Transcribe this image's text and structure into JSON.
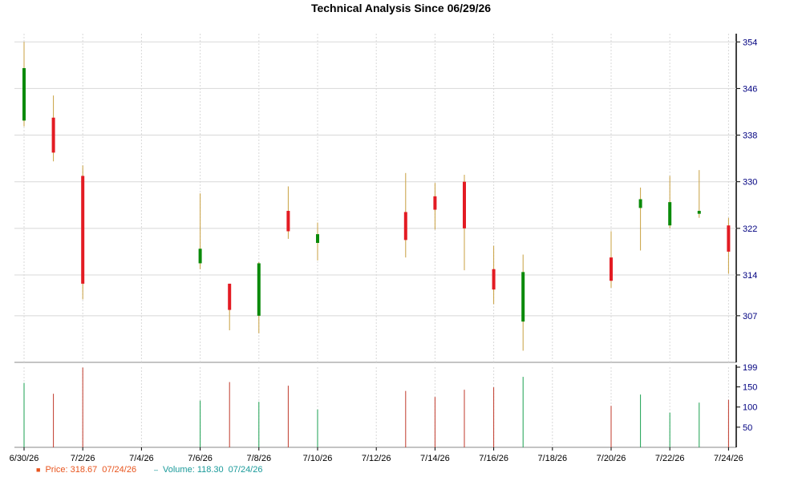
{
  "chart_data": {
    "type": "candlestick",
    "title": "Technical Analysis Since 06/29/26",
    "price_axis": {
      "ylim": [
        299,
        355
      ],
      "ticks": [
        307,
        314,
        322,
        330,
        338,
        346,
        354
      ]
    },
    "volume_axis": {
      "ylim": [
        0,
        199
      ],
      "ticks": [
        50,
        100,
        150,
        199
      ]
    },
    "x_tick_labels": [
      "6/30/26",
      "7/2/26",
      "7/4/26",
      "7/6/26",
      "7/8/26",
      "7/10/26",
      "7/12/26",
      "7/14/26",
      "7/16/26",
      "7/18/26",
      "7/20/26",
      "7/22/26",
      "7/24/26"
    ],
    "grid": true,
    "candles": [
      {
        "date": "6/30/26",
        "open": 340.5,
        "high": 354.0,
        "low": 339.5,
        "close": 349.5,
        "volume": 160
      },
      {
        "date": "7/1/26",
        "open": 341.0,
        "high": 344.8,
        "low": 333.5,
        "close": 335.0,
        "volume": 133
      },
      {
        "date": "7/2/26",
        "open": 331.0,
        "high": 332.8,
        "low": 309.8,
        "close": 312.5,
        "volume": 198
      },
      {
        "date": "7/6/26",
        "open": 316.0,
        "high": 328.0,
        "low": 315.0,
        "close": 318.5,
        "volume": 116
      },
      {
        "date": "7/7/26",
        "open": 312.5,
        "high": 312.5,
        "low": 304.5,
        "close": 308.0,
        "volume": 162
      },
      {
        "date": "7/8/26",
        "open": 307.0,
        "high": 316.2,
        "low": 304.0,
        "close": 316.0,
        "volume": 113
      },
      {
        "date": "7/9/26",
        "open": 325.0,
        "high": 329.2,
        "low": 320.2,
        "close": 321.5,
        "volume": 153
      },
      {
        "date": "7/10/26",
        "open": 319.5,
        "high": 323.0,
        "low": 316.5,
        "close": 321.0,
        "volume": 94
      },
      {
        "date": "7/13/26",
        "open": 324.8,
        "high": 331.5,
        "low": 317.0,
        "close": 320.0,
        "volume": 140
      },
      {
        "date": "7/14/26",
        "open": 327.5,
        "high": 329.8,
        "low": 321.8,
        "close": 325.2,
        "volume": 125
      },
      {
        "date": "7/15/26",
        "open": 330.0,
        "high": 331.2,
        "low": 314.8,
        "close": 322.0,
        "volume": 143
      },
      {
        "date": "7/16/26",
        "open": 315.0,
        "high": 319.0,
        "low": 309.0,
        "close": 311.5,
        "volume": 149
      },
      {
        "date": "7/17/26",
        "open": 306.0,
        "high": 317.5,
        "low": 301.0,
        "close": 314.5,
        "volume": 175
      },
      {
        "date": "7/20/26",
        "open": 317.0,
        "high": 321.5,
        "low": 311.8,
        "close": 313.0,
        "volume": 103
      },
      {
        "date": "7/21/26",
        "open": 325.5,
        "high": 329.0,
        "low": 318.2,
        "close": 327.0,
        "volume": 131
      },
      {
        "date": "7/22/26",
        "open": 322.5,
        "high": 331.0,
        "low": 322.0,
        "close": 326.5,
        "volume": 86
      },
      {
        "date": "7/23/26",
        "open": 324.5,
        "high": 332.0,
        "low": 323.8,
        "close": 325.0,
        "volume": 111
      },
      {
        "date": "7/24/26",
        "open": 322.5,
        "high": 323.8,
        "low": 314.2,
        "close": 318.0,
        "volume": 118
      }
    ]
  },
  "legend": {
    "price_label": "Price: 318.67",
    "price_date": "07/24/26",
    "volume_label": "Volume: 118.30",
    "volume_date": "07/24/26",
    "price_marker": "■",
    "volume_marker": "–"
  },
  "colors": {
    "up": "#0a8a0a",
    "down": "#e31b23",
    "wick": "#c8a040",
    "volume_up": "#1aa050",
    "volume_down": "#c0392b",
    "axis_label": "#000080",
    "grid": "#d8d8d8"
  }
}
